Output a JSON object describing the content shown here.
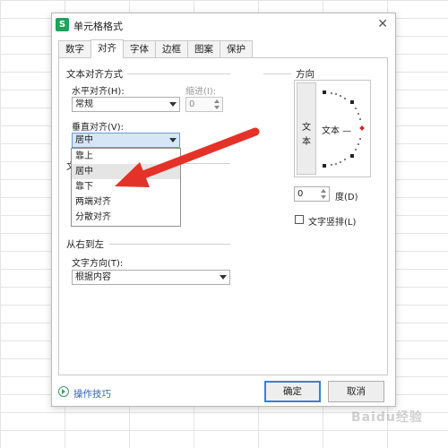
{
  "dialog": {
    "title": "单元格格式",
    "app_icon_text": "S"
  },
  "tabs": [
    {
      "label": "数字"
    },
    {
      "label": "对齐"
    },
    {
      "label": "字体"
    },
    {
      "label": "边框"
    },
    {
      "label": "图案"
    },
    {
      "label": "保护"
    }
  ],
  "text_alignment": {
    "section_title": "文本对齐方式",
    "horizontal_label": "水平对齐(H):",
    "horizontal_value": "常规",
    "indent_label": "缩进(I):",
    "indent_value": "0",
    "vertical_label": "垂直对齐(V):",
    "vertical_value": "居中",
    "vertical_options": [
      "靠上",
      "居中",
      "靠下",
      "两端对齐",
      "分散对齐"
    ],
    "hidden_section_prefix": "文"
  },
  "rtl": {
    "section_title": "从右到左",
    "direction_label": "文字方向(T):",
    "direction_value": "根据内容"
  },
  "orientation": {
    "section_title": "方向",
    "vertical_text": [
      "文",
      "本"
    ],
    "text_label": "文本 —",
    "degree_value": "0",
    "degree_label": "度(D)",
    "vertical_layout_label": "文字竖排(L)"
  },
  "footer": {
    "tips_label": "操作技巧",
    "ok_label": "确定",
    "cancel_label": "取消"
  },
  "watermark_text": "Baidu经验",
  "colors": {
    "arrow_red": "#e53228",
    "accent_blue": "#3b7ed4",
    "app_green": "#1fa35b"
  }
}
